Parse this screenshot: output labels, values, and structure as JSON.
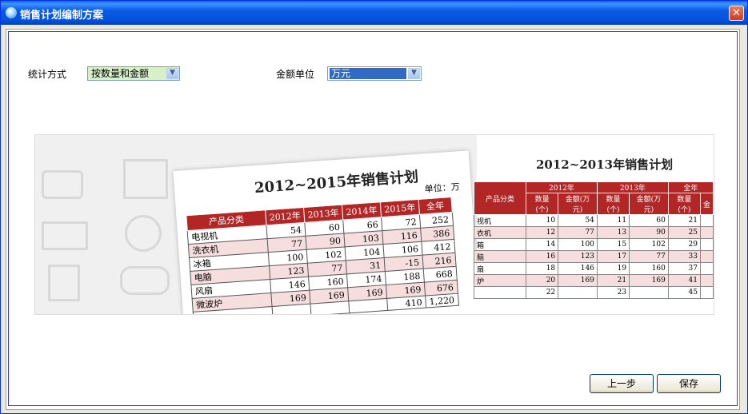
{
  "window": {
    "title": "销售计划编制方案",
    "close_glyph": "✕"
  },
  "form": {
    "stat_method_label": "统计方式",
    "stat_method_value": "按数量和金额",
    "amount_unit_label": "金额单位",
    "amount_unit_value": "万元"
  },
  "preview": {
    "left_sheet": {
      "title": "2012~2015年销售计划",
      "unit": "单位：万",
      "headers": [
        "产品分类",
        "2012年",
        "2013年",
        "2014年",
        "2015年",
        "全年"
      ],
      "rows": [
        [
          "电视机",
          "54",
          "60",
          "66",
          "72",
          "252"
        ],
        [
          "洗衣机",
          "77",
          "90",
          "103",
          "116",
          "386"
        ],
        [
          "冰箱",
          "100",
          "102",
          "104",
          "106",
          "412"
        ],
        [
          "电脑",
          "123",
          "77",
          "31",
          "-15",
          "216"
        ],
        [
          "风扇",
          "146",
          "160",
          "174",
          "188",
          "668"
        ],
        [
          "微波炉",
          "169",
          "169",
          "169",
          "169",
          "676"
        ],
        [
          "",
          "",
          "",
          "",
          "410",
          "1,220"
        ]
      ]
    },
    "right_sheet": {
      "title": "2012~2013年销售计划",
      "group_headers": [
        "产品分类",
        "2012年",
        "2013年",
        "全年"
      ],
      "sub_headers": [
        "数量(个)",
        "金额(万元)",
        "数量(个)",
        "金额(万元)",
        "数量(个)",
        "金"
      ],
      "rows": [
        [
          "视机",
          "10",
          "54",
          "11",
          "60",
          "21",
          ""
        ],
        [
          "衣机",
          "12",
          "77",
          "13",
          "90",
          "25",
          ""
        ],
        [
          "箱",
          "14",
          "100",
          "15",
          "102",
          "29",
          ""
        ],
        [
          "脑",
          "16",
          "123",
          "17",
          "77",
          "33",
          ""
        ],
        [
          "扇",
          "18",
          "146",
          "19",
          "160",
          "37",
          ""
        ],
        [
          "炉",
          "20",
          "169",
          "21",
          "169",
          "41",
          ""
        ],
        [
          "",
          "22",
          "",
          "23",
          "",
          "45",
          ""
        ]
      ]
    }
  },
  "buttons": {
    "prev_label": "上一步",
    "save_label": "保存"
  },
  "colors": {
    "titlebar": "#0453d9",
    "table_header": "#b32626",
    "selected_combo": "#316ac5",
    "green_combo": "#d8f0c8"
  }
}
